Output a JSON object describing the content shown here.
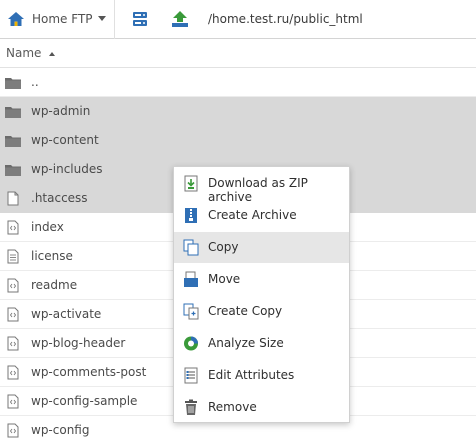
{
  "toolbar": {
    "site_name": "Home FTP",
    "path": "/home.test.ru/public_html"
  },
  "header": {
    "name_label": "Name"
  },
  "files": [
    {
      "name": "..",
      "type": "folder",
      "selected": false
    },
    {
      "name": "wp-admin",
      "type": "folder",
      "selected": true
    },
    {
      "name": "wp-content",
      "type": "folder",
      "selected": true
    },
    {
      "name": "wp-includes",
      "type": "folder",
      "selected": true
    },
    {
      "name": ".htaccess",
      "type": "file",
      "selected": true
    },
    {
      "name": "index",
      "type": "code",
      "selected": false
    },
    {
      "name": "license",
      "type": "text",
      "selected": false
    },
    {
      "name": "readme",
      "type": "code",
      "selected": false
    },
    {
      "name": "wp-activate",
      "type": "code",
      "selected": false
    },
    {
      "name": "wp-blog-header",
      "type": "code",
      "selected": false
    },
    {
      "name": "wp-comments-post",
      "type": "code",
      "selected": false
    },
    {
      "name": "wp-config-sample",
      "type": "code",
      "selected": false
    },
    {
      "name": "wp-config",
      "type": "code",
      "selected": false
    }
  ],
  "context_menu": {
    "items": [
      {
        "label": "Download as ZIP archive",
        "icon": "zip-download-icon",
        "highlighted": false
      },
      {
        "label": "Create Archive",
        "icon": "archive-icon",
        "highlighted": false
      },
      {
        "label": "Copy",
        "icon": "copy-icon",
        "highlighted": true
      },
      {
        "label": "Move",
        "icon": "move-icon",
        "highlighted": false
      },
      {
        "label": "Create Copy",
        "icon": "create-copy-icon",
        "highlighted": false
      },
      {
        "label": "Analyze Size",
        "icon": "pie-chart-icon",
        "highlighted": false
      },
      {
        "label": "Edit Attributes",
        "icon": "attributes-icon",
        "highlighted": false
      },
      {
        "label": "Remove",
        "icon": "trash-icon",
        "highlighted": false
      }
    ]
  },
  "colors": {
    "selected_row": "#d8d8d8",
    "menu_highlight": "#e6e6e6",
    "accent_blue": "#2f6fb5",
    "accent_green": "#3a9a3a"
  }
}
